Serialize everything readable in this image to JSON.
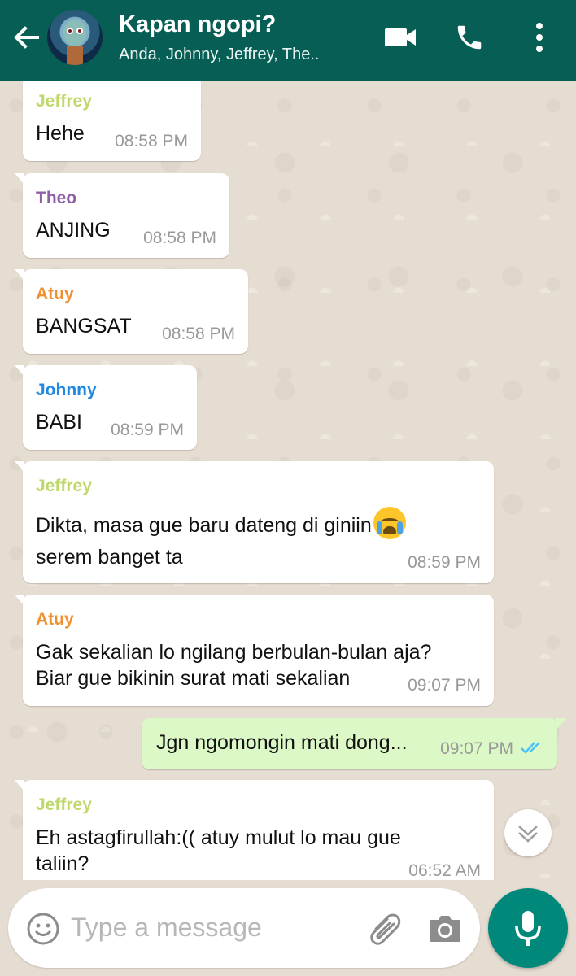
{
  "header": {
    "title": "Kapan ngopi?",
    "subtitle": "Anda, Johnny, Jeffrey, The.."
  },
  "colors": {
    "header": "#075e54",
    "incoming": "#ffffff",
    "outgoing": "#dcf8c6",
    "jeffrey": "#bfd86a",
    "theo": "#8e5fa8",
    "atuy": "#f0912f",
    "johnny": "#1e88e5",
    "read_ticks": "#4fc3f7",
    "mic": "#00897b"
  },
  "messages": [
    {
      "sender": "Jeffrey",
      "text": "Hehe",
      "time": "08:58 PM"
    },
    {
      "sender": "Theo",
      "text": "ANJING",
      "time": "08:58 PM"
    },
    {
      "sender": "Atuy",
      "text": "BANGSAT",
      "time": "08:58 PM"
    },
    {
      "sender": "Johnny",
      "text": "BABI",
      "time": "08:59 PM"
    },
    {
      "sender": "Jeffrey",
      "line1": "Dikta, masa gue baru dateng di giniin",
      "emoji": "crying-face",
      "line2": "serem banget ta",
      "time": "08:59 PM"
    },
    {
      "sender": "Atuy",
      "line1": "Gak sekalian lo ngilang berbulan-bulan aja?",
      "line2": "Biar gue bikinin surat mati sekalian",
      "time": "09:07 PM"
    },
    {
      "sender": "Anda",
      "text": "Jgn ngomongin mati dong...",
      "time": "09:07 PM",
      "status": "read"
    },
    {
      "sender": "Jeffrey",
      "line1": "Eh astagfirullah:(( atuy mulut lo mau gue",
      "line2": "taliin?",
      "time": "06:52 AM"
    }
  ],
  "composer": {
    "placeholder": "Type a message"
  }
}
